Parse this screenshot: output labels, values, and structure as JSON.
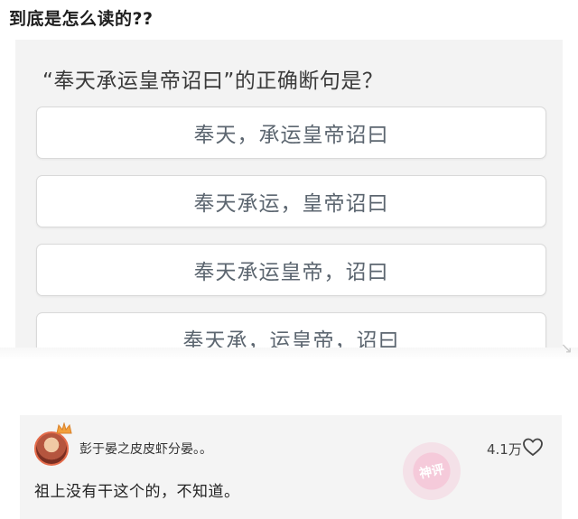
{
  "post": {
    "title": "到底是怎么读的??"
  },
  "quiz": {
    "question": "“奉天承运皇帝诏曰”的正确断句是？",
    "options": [
      "奉天，承运皇帝诏曰",
      "奉天承运，皇帝诏曰",
      "奉天承运皇帝，诏曰",
      "奉天承，运皇帝，诏曰"
    ]
  },
  "comment": {
    "username": "彭于晏之皮皮虾分晏。。",
    "likes": "4.1万",
    "text": "祖上没有干这个的，不知道。",
    "stamp": "神评"
  },
  "icons": {
    "avatar_badge": "crown-icon",
    "like": "heart-icon"
  },
  "colors": {
    "badge": "#f2a03c",
    "stamp": "#f6a8c4",
    "option_text": "#5c6670"
  }
}
